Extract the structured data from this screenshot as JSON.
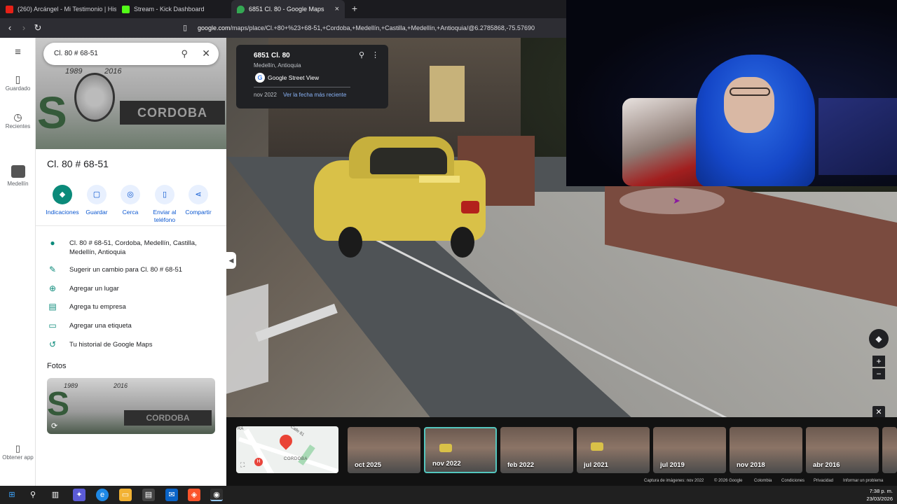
{
  "browser": {
    "tabs": [
      {
        "title": "(260) Arcángel - Mi Testimonio | Hist",
        "color": "#e62117"
      },
      {
        "title": "Stream - Kick Dashboard",
        "color": "#53fc18"
      },
      {
        "title": "6851 Cl. 80 - Google Maps",
        "color": "#34a853"
      }
    ],
    "new_tab": "+",
    "close_tab": "×",
    "url_host": "google.com",
    "url_path": "/maps/place/Cl.+80+%23+68-51,+Cordoba,+Medellín,+Castilla,+Medellín,+Antioquia/@6.2785868,-75.57690"
  },
  "rail": {
    "menu": "≡",
    "saved": "Guardado",
    "recent": "Recientes",
    "medellin": "Medellín",
    "get_app": "Obtener app"
  },
  "search": {
    "query": "Cl. 80 # 68-51"
  },
  "hero": {
    "year_left": "1989",
    "year_right": "2016",
    "mural_text": "CORDOBA",
    "letter": "S"
  },
  "place": {
    "title": "Cl. 80 # 68-51",
    "actions": [
      {
        "label": "Indicaciones",
        "icon": "◆"
      },
      {
        "label": "Guardar",
        "icon": "▢"
      },
      {
        "label": "Cerca",
        "icon": "◎"
      },
      {
        "label": "Enviar al teléfono",
        "icon": "▯"
      },
      {
        "label": "Compartir",
        "icon": "⋖"
      }
    ],
    "rows": [
      {
        "icon": "●",
        "text": "Cl. 80 # 68-51, Cordoba, Medellín, Castilla, Medellín, Antioquia"
      },
      {
        "icon": "✎",
        "text": "Sugerir un cambio para Cl. 80 # 68-51"
      },
      {
        "icon": "⊕",
        "text": "Agregar un lugar"
      },
      {
        "icon": "▤",
        "text": "Agrega tu empresa"
      },
      {
        "icon": "▭",
        "text": "Agregar una etiqueta"
      },
      {
        "icon": "↺",
        "text": "Tu historial de Google Maps"
      }
    ],
    "photos_heading": "Fotos",
    "photo_year_left": "1989",
    "photo_year_right": "2016",
    "photo_text": "CORDOBA"
  },
  "streetview": {
    "card_title": "6851 Cl. 80",
    "card_subtitle": "Medellín, Antioquia",
    "brand": "Google Street View",
    "date": "nov 2022",
    "latest_link": "Ver la fecha más reciente"
  },
  "timeline": {
    "minimap_street": "Calle 81",
    "minimap_area": "CORDOBA",
    "minimap_corner": "RA",
    "thumbs": [
      {
        "label": "oct 2025",
        "selected": false
      },
      {
        "label": "nov 2022",
        "selected": true
      },
      {
        "label": "feb 2022",
        "selected": false
      },
      {
        "label": "jul 2021",
        "selected": false
      },
      {
        "label": "jul 2019",
        "selected": false
      },
      {
        "label": "nov 2018",
        "selected": false
      },
      {
        "label": "abr 2016",
        "selected": false
      }
    ],
    "footer": [
      "Captura de imágenes: nov 2022",
      "© 2026 Google",
      "Colombia",
      "Condiciones",
      "Privacidad",
      "Informar un problema"
    ]
  },
  "clock": {
    "time": "7:38 p. m.",
    "date": "23/03/2026"
  },
  "colors": {
    "accent": "#0b57d0",
    "teal": "#0b8a7a",
    "selected_border": "#54c6be"
  }
}
